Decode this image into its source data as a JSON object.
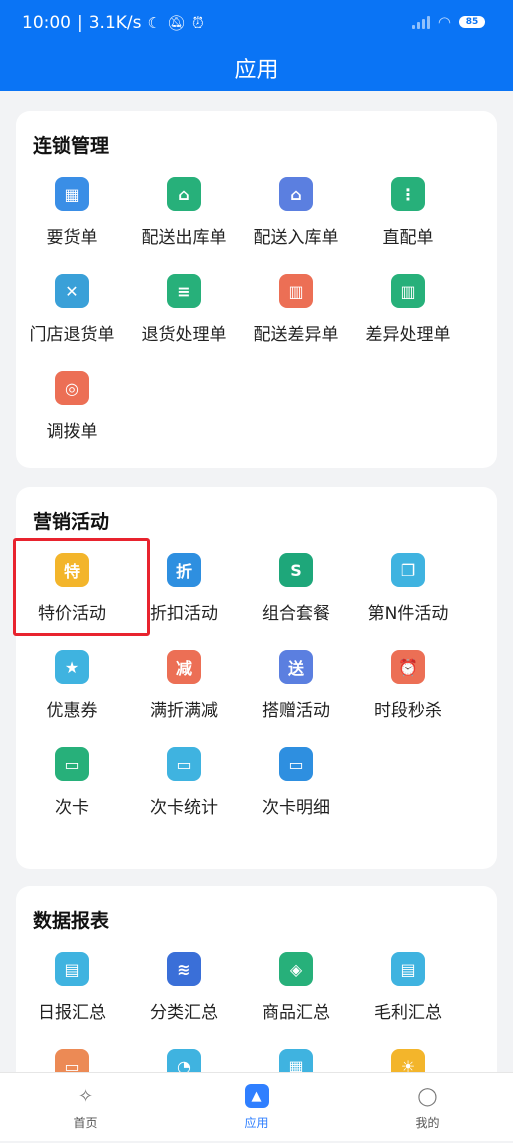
{
  "status_bar": {
    "time": "10:00",
    "speed": "3.1K/s",
    "battery": "85"
  },
  "header": {
    "title": "应用"
  },
  "sections": [
    {
      "title": "连锁管理",
      "items": [
        {
          "label": "要货单",
          "icon": "order-icon",
          "color": "#3a8ee6",
          "glyph": "▦"
        },
        {
          "label": "配送出库单",
          "icon": "warehouse-out-icon",
          "color": "#27b07a",
          "glyph": "⌂"
        },
        {
          "label": "配送入库单",
          "icon": "warehouse-in-icon",
          "color": "#5b7fe0",
          "glyph": "⌂"
        },
        {
          "label": "直配单",
          "icon": "direct-delivery-icon",
          "color": "#27b07a",
          "glyph": "⋮"
        },
        {
          "label": "门店退货单",
          "icon": "store-return-icon",
          "color": "#3aa0d8",
          "glyph": "✕"
        },
        {
          "label": "退货处理单",
          "icon": "return-process-icon",
          "color": "#27b07a",
          "glyph": "≡"
        },
        {
          "label": "配送差异单",
          "icon": "delivery-diff-icon",
          "color": "#ec6f55",
          "glyph": "▥"
        },
        {
          "label": "差异处理单",
          "icon": "diff-process-icon",
          "color": "#27b07a",
          "glyph": "▥"
        },
        {
          "label": "调拨单",
          "icon": "transfer-icon",
          "color": "#ec6f55",
          "glyph": "◎"
        }
      ]
    },
    {
      "title": "营销活动",
      "items": [
        {
          "label": "特价活动",
          "icon": "special-price-icon",
          "color": "#f3b52b",
          "glyph": "特"
        },
        {
          "label": "折扣活动",
          "icon": "discount-icon",
          "color": "#2e8fe0",
          "glyph": "折"
        },
        {
          "label": "组合套餐",
          "icon": "combo-icon",
          "color": "#1ea77a",
          "glyph": "S"
        },
        {
          "label": "第N件活动",
          "icon": "nth-item-icon",
          "color": "#3fb3e0",
          "glyph": "❐"
        },
        {
          "label": "优惠券",
          "icon": "coupon-icon",
          "color": "#3fb3e0",
          "glyph": "★"
        },
        {
          "label": "满折满减",
          "icon": "full-reduction-icon",
          "color": "#ec6f55",
          "glyph": "减"
        },
        {
          "label": "搭赠活动",
          "icon": "gift-icon",
          "color": "#5b7fe0",
          "glyph": "送"
        },
        {
          "label": "时段秒杀",
          "icon": "flash-sale-icon",
          "color": "#ec6f55",
          "glyph": "⏰"
        },
        {
          "label": "次卡",
          "icon": "count-card-icon",
          "color": "#27b07a",
          "glyph": "▭"
        },
        {
          "label": "次卡统计",
          "icon": "count-card-stats-icon",
          "color": "#3fb3e0",
          "glyph": "▭"
        },
        {
          "label": "次卡明细",
          "icon": "count-card-detail-icon",
          "color": "#2e8fe0",
          "glyph": "▭"
        }
      ]
    },
    {
      "title": "数据报表",
      "items": [
        {
          "label": "日报汇总",
          "icon": "daily-report-icon",
          "color": "#3fb3e0",
          "glyph": "▤"
        },
        {
          "label": "分类汇总",
          "icon": "category-summary-icon",
          "color": "#3a6fd8",
          "glyph": "≋"
        },
        {
          "label": "商品汇总",
          "icon": "product-summary-icon",
          "color": "#27b07a",
          "glyph": "◈"
        },
        {
          "label": "毛利汇总",
          "icon": "gross-profit-icon",
          "color": "#3fb3e0",
          "glyph": "▤"
        },
        {
          "label": "",
          "icon": "report-icon",
          "color": "#ec8a55",
          "glyph": "▭"
        },
        {
          "label": "",
          "icon": "report-icon",
          "color": "#3fb3e0",
          "glyph": "◔"
        },
        {
          "label": "",
          "icon": "report-icon",
          "color": "#3fb3e0",
          "glyph": "▦"
        },
        {
          "label": "",
          "icon": "report-icon",
          "color": "#f3b52b",
          "glyph": "☀"
        }
      ]
    }
  ],
  "tabbar": [
    {
      "label": "首页",
      "icon": "home-icon",
      "glyph": "✧"
    },
    {
      "label": "应用",
      "icon": "apps-icon",
      "glyph": "▲"
    },
    {
      "label": "我的",
      "icon": "profile-icon",
      "glyph": "◯"
    }
  ]
}
